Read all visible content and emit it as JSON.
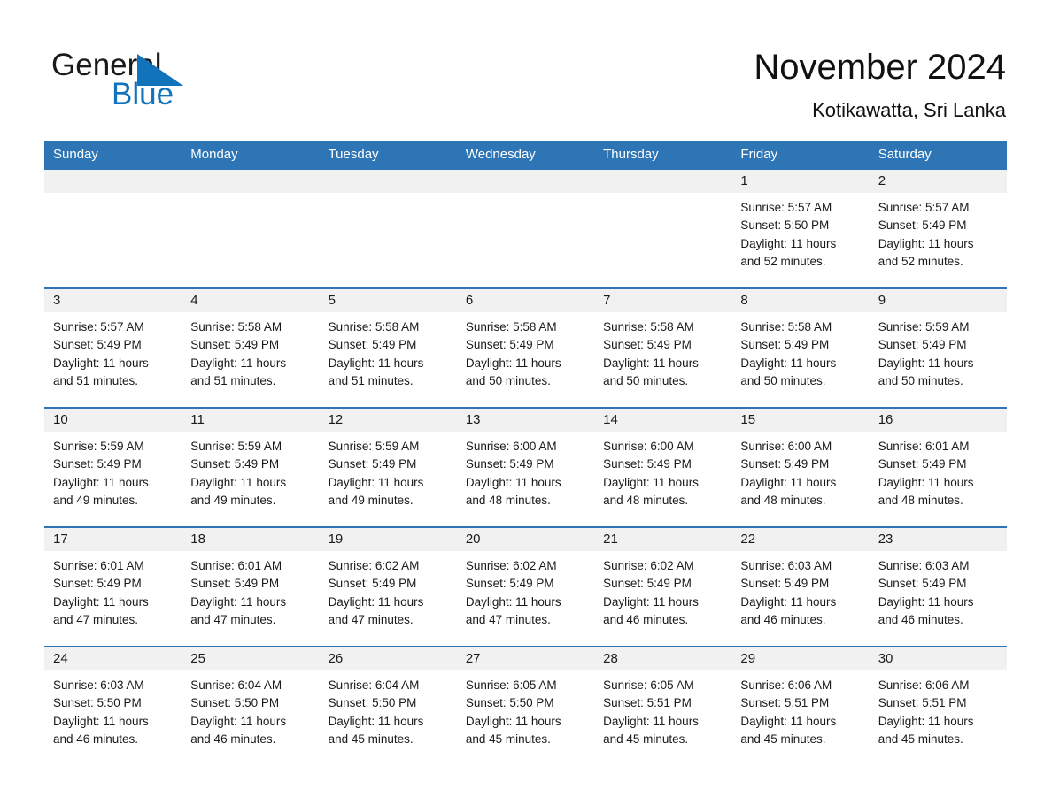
{
  "brand": {
    "name_part1": "General",
    "name_part2": "Blue",
    "triangle_color": "#1273bd"
  },
  "header": {
    "month_title": "November 2024",
    "location": "Kotikawatta, Sri Lanka",
    "header_bg": "#2e75b6",
    "daynum_bg": "#f1f1f1"
  },
  "weekdays": [
    "Sunday",
    "Monday",
    "Tuesday",
    "Wednesday",
    "Thursday",
    "Friday",
    "Saturday"
  ],
  "weeks": [
    [
      {
        "day": "",
        "empty": true
      },
      {
        "day": "",
        "empty": true
      },
      {
        "day": "",
        "empty": true
      },
      {
        "day": "",
        "empty": true
      },
      {
        "day": "",
        "empty": true
      },
      {
        "day": "1",
        "sunrise": "Sunrise: 5:57 AM",
        "sunset": "Sunset: 5:50 PM",
        "daylight_line1": "Daylight: 11 hours",
        "daylight_line2": "and 52 minutes."
      },
      {
        "day": "2",
        "sunrise": "Sunrise: 5:57 AM",
        "sunset": "Sunset: 5:49 PM",
        "daylight_line1": "Daylight: 11 hours",
        "daylight_line2": "and 52 minutes."
      }
    ],
    [
      {
        "day": "3",
        "sunrise": "Sunrise: 5:57 AM",
        "sunset": "Sunset: 5:49 PM",
        "daylight_line1": "Daylight: 11 hours",
        "daylight_line2": "and 51 minutes."
      },
      {
        "day": "4",
        "sunrise": "Sunrise: 5:58 AM",
        "sunset": "Sunset: 5:49 PM",
        "daylight_line1": "Daylight: 11 hours",
        "daylight_line2": "and 51 minutes."
      },
      {
        "day": "5",
        "sunrise": "Sunrise: 5:58 AM",
        "sunset": "Sunset: 5:49 PM",
        "daylight_line1": "Daylight: 11 hours",
        "daylight_line2": "and 51 minutes."
      },
      {
        "day": "6",
        "sunrise": "Sunrise: 5:58 AM",
        "sunset": "Sunset: 5:49 PM",
        "daylight_line1": "Daylight: 11 hours",
        "daylight_line2": "and 50 minutes."
      },
      {
        "day": "7",
        "sunrise": "Sunrise: 5:58 AM",
        "sunset": "Sunset: 5:49 PM",
        "daylight_line1": "Daylight: 11 hours",
        "daylight_line2": "and 50 minutes."
      },
      {
        "day": "8",
        "sunrise": "Sunrise: 5:58 AM",
        "sunset": "Sunset: 5:49 PM",
        "daylight_line1": "Daylight: 11 hours",
        "daylight_line2": "and 50 minutes."
      },
      {
        "day": "9",
        "sunrise": "Sunrise: 5:59 AM",
        "sunset": "Sunset: 5:49 PM",
        "daylight_line1": "Daylight: 11 hours",
        "daylight_line2": "and 50 minutes."
      }
    ],
    [
      {
        "day": "10",
        "sunrise": "Sunrise: 5:59 AM",
        "sunset": "Sunset: 5:49 PM",
        "daylight_line1": "Daylight: 11 hours",
        "daylight_line2": "and 49 minutes."
      },
      {
        "day": "11",
        "sunrise": "Sunrise: 5:59 AM",
        "sunset": "Sunset: 5:49 PM",
        "daylight_line1": "Daylight: 11 hours",
        "daylight_line2": "and 49 minutes."
      },
      {
        "day": "12",
        "sunrise": "Sunrise: 5:59 AM",
        "sunset": "Sunset: 5:49 PM",
        "daylight_line1": "Daylight: 11 hours",
        "daylight_line2": "and 49 minutes."
      },
      {
        "day": "13",
        "sunrise": "Sunrise: 6:00 AM",
        "sunset": "Sunset: 5:49 PM",
        "daylight_line1": "Daylight: 11 hours",
        "daylight_line2": "and 48 minutes."
      },
      {
        "day": "14",
        "sunrise": "Sunrise: 6:00 AM",
        "sunset": "Sunset: 5:49 PM",
        "daylight_line1": "Daylight: 11 hours",
        "daylight_line2": "and 48 minutes."
      },
      {
        "day": "15",
        "sunrise": "Sunrise: 6:00 AM",
        "sunset": "Sunset: 5:49 PM",
        "daylight_line1": "Daylight: 11 hours",
        "daylight_line2": "and 48 minutes."
      },
      {
        "day": "16",
        "sunrise": "Sunrise: 6:01 AM",
        "sunset": "Sunset: 5:49 PM",
        "daylight_line1": "Daylight: 11 hours",
        "daylight_line2": "and 48 minutes."
      }
    ],
    [
      {
        "day": "17",
        "sunrise": "Sunrise: 6:01 AM",
        "sunset": "Sunset: 5:49 PM",
        "daylight_line1": "Daylight: 11 hours",
        "daylight_line2": "and 47 minutes."
      },
      {
        "day": "18",
        "sunrise": "Sunrise: 6:01 AM",
        "sunset": "Sunset: 5:49 PM",
        "daylight_line1": "Daylight: 11 hours",
        "daylight_line2": "and 47 minutes."
      },
      {
        "day": "19",
        "sunrise": "Sunrise: 6:02 AM",
        "sunset": "Sunset: 5:49 PM",
        "daylight_line1": "Daylight: 11 hours",
        "daylight_line2": "and 47 minutes."
      },
      {
        "day": "20",
        "sunrise": "Sunrise: 6:02 AM",
        "sunset": "Sunset: 5:49 PM",
        "daylight_line1": "Daylight: 11 hours",
        "daylight_line2": "and 47 minutes."
      },
      {
        "day": "21",
        "sunrise": "Sunrise: 6:02 AM",
        "sunset": "Sunset: 5:49 PM",
        "daylight_line1": "Daylight: 11 hours",
        "daylight_line2": "and 46 minutes."
      },
      {
        "day": "22",
        "sunrise": "Sunrise: 6:03 AM",
        "sunset": "Sunset: 5:49 PM",
        "daylight_line1": "Daylight: 11 hours",
        "daylight_line2": "and 46 minutes."
      },
      {
        "day": "23",
        "sunrise": "Sunrise: 6:03 AM",
        "sunset": "Sunset: 5:49 PM",
        "daylight_line1": "Daylight: 11 hours",
        "daylight_line2": "and 46 minutes."
      }
    ],
    [
      {
        "day": "24",
        "sunrise": "Sunrise: 6:03 AM",
        "sunset": "Sunset: 5:50 PM",
        "daylight_line1": "Daylight: 11 hours",
        "daylight_line2": "and 46 minutes."
      },
      {
        "day": "25",
        "sunrise": "Sunrise: 6:04 AM",
        "sunset": "Sunset: 5:50 PM",
        "daylight_line1": "Daylight: 11 hours",
        "daylight_line2": "and 46 minutes."
      },
      {
        "day": "26",
        "sunrise": "Sunrise: 6:04 AM",
        "sunset": "Sunset: 5:50 PM",
        "daylight_line1": "Daylight: 11 hours",
        "daylight_line2": "and 45 minutes."
      },
      {
        "day": "27",
        "sunrise": "Sunrise: 6:05 AM",
        "sunset": "Sunset: 5:50 PM",
        "daylight_line1": "Daylight: 11 hours",
        "daylight_line2": "and 45 minutes."
      },
      {
        "day": "28",
        "sunrise": "Sunrise: 6:05 AM",
        "sunset": "Sunset: 5:51 PM",
        "daylight_line1": "Daylight: 11 hours",
        "daylight_line2": "and 45 minutes."
      },
      {
        "day": "29",
        "sunrise": "Sunrise: 6:06 AM",
        "sunset": "Sunset: 5:51 PM",
        "daylight_line1": "Daylight: 11 hours",
        "daylight_line2": "and 45 minutes."
      },
      {
        "day": "30",
        "sunrise": "Sunrise: 6:06 AM",
        "sunset": "Sunset: 5:51 PM",
        "daylight_line1": "Daylight: 11 hours",
        "daylight_line2": "and 45 minutes."
      }
    ]
  ]
}
